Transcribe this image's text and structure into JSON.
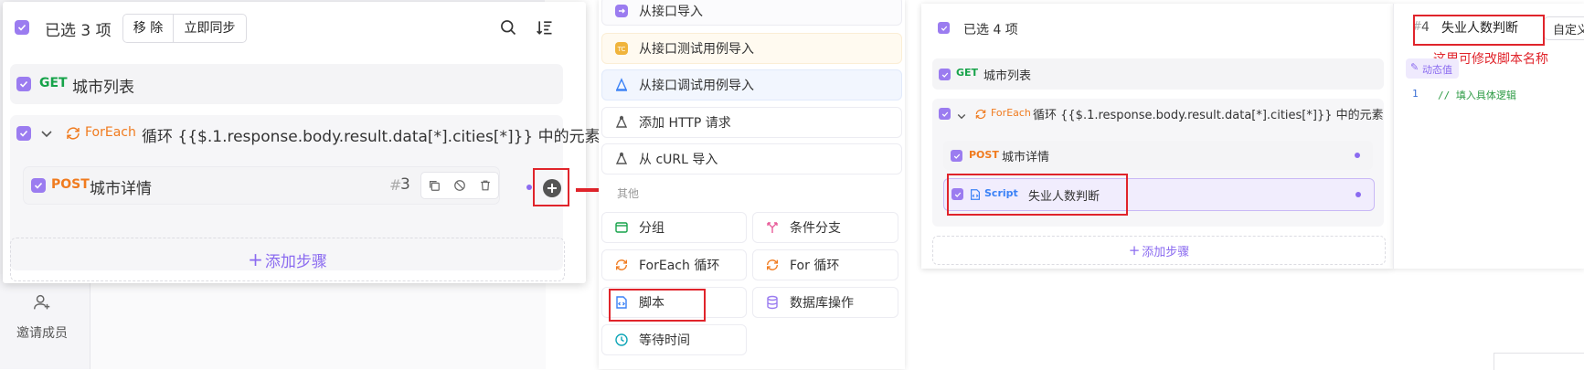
{
  "left_panel": {
    "selected_text": "已选 3 项",
    "remove_button": "移 除",
    "sync_button": "立即同步",
    "step1": {
      "method": "GET",
      "name": "城市列表"
    },
    "foreach": {
      "tag": "ForEach",
      "text": "循环 {{$.1.response.body.result.data[*].cities[*]}} 中的元素"
    },
    "step2": {
      "method": "POST",
      "name": "城市详情",
      "index": "3"
    },
    "add_step": "添加步骤",
    "invite": "邀请成员"
  },
  "menu": {
    "items_top": [
      {
        "label": "从接口导入",
        "icon": "import-icon"
      },
      {
        "label": "从接口测试用例导入",
        "icon": "tc-icon"
      },
      {
        "label": "从接口调试用例导入",
        "icon": "debug-case-icon"
      },
      {
        "label": "添加 HTTP 请求",
        "icon": "http-icon"
      },
      {
        "label": "从 cURL 导入",
        "icon": "curl-icon"
      }
    ],
    "section_label": "其他",
    "grid_items": [
      {
        "label": "分组",
        "icon": "group-icon"
      },
      {
        "label": "条件分支",
        "icon": "branch-icon"
      },
      {
        "label": "ForEach 循环",
        "icon": "loop-icon"
      },
      {
        "label": "For 循环",
        "icon": "loop-icon"
      },
      {
        "label": "脚本",
        "icon": "script-icon"
      },
      {
        "label": "数据库操作",
        "icon": "database-icon"
      },
      {
        "label": "等待时间",
        "icon": "clock-icon"
      }
    ]
  },
  "right_panel": {
    "selected_text": "已选 4 项",
    "step1": {
      "method": "GET",
      "name": "城市列表"
    },
    "foreach": {
      "tag": "ForEach",
      "text": "循环 {{$.1.response.body.result.data[*].cities[*]}} 中的元素"
    },
    "step2": {
      "method": "POST",
      "name": "城市详情"
    },
    "step3": {
      "method": "Script",
      "name": "失业人数判断"
    },
    "add_step": "添加步骤",
    "script_index": "4",
    "script_name": "失业人数判断",
    "custom_tab": "自定义",
    "annotation": "这里可修改脚本名称",
    "dynamic_value": "动态值",
    "code_line_no": "1",
    "code_line": "// 填入具体逻辑"
  },
  "colors": {
    "accent": "#9b7cf0",
    "red": "#e0242b",
    "get": "#17a34a",
    "post": "#f07b1f",
    "script_blue": "#3b82f6"
  }
}
